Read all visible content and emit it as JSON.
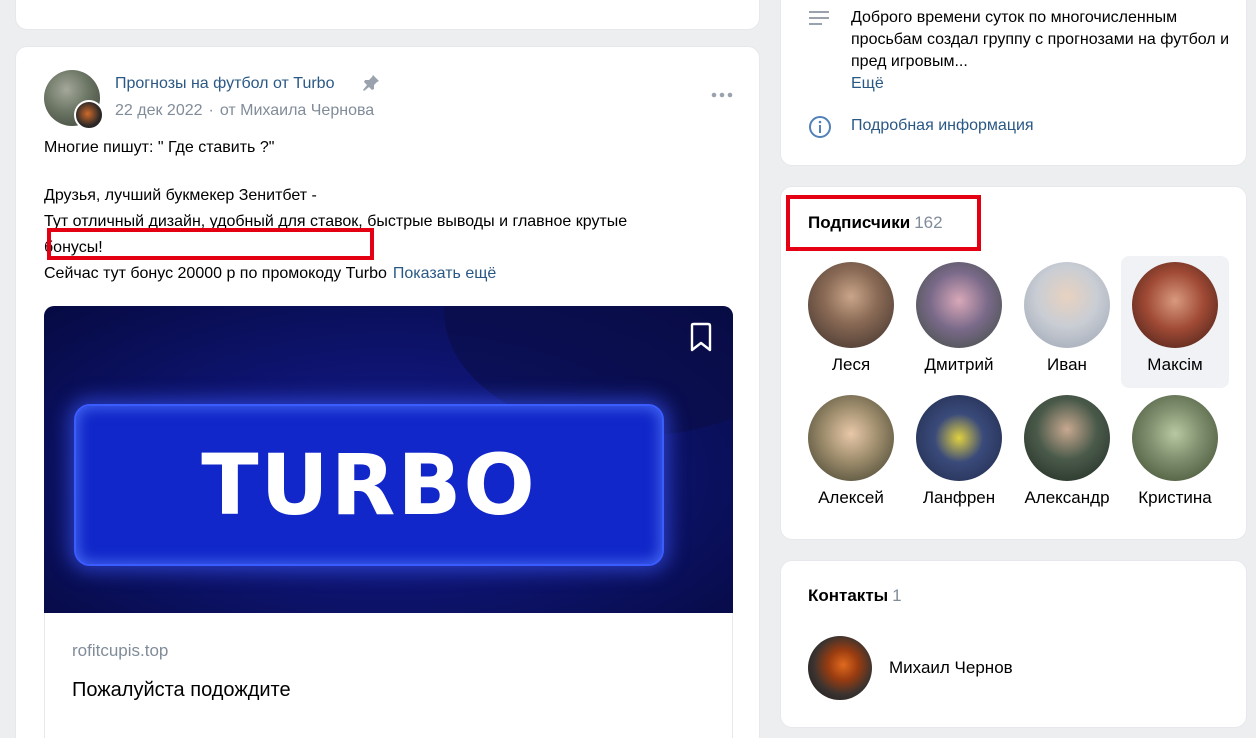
{
  "post": {
    "author": "Прогнозы на футбол от Turbo",
    "date": "22 дек 2022",
    "meta_separator": "·",
    "from": "от Михаила Чернова",
    "lines": [
      "Многие пишут: \" Где ставить ?\"",
      "Друзья, лучший букмекер Зенитбет -",
      "Тут отличный дизайн, удобный для ставок, быстрые выводы и главное крутые",
      "бонусы!",
      "Сейчас тут бонус 20000 р по промокоду Turbo"
    ],
    "show_more": "Показать ещё",
    "media_text": "TURBO",
    "link_domain": "rofitcupis.top",
    "link_title": "Пожалуйста подождите"
  },
  "info": {
    "description": "Доброго времени суток по многочисленным просьбам создал группу с прогнозами на футбол и пред игровым...",
    "more": "Ещё",
    "details_link": "Подробная информация"
  },
  "subscribers": {
    "title": "Подписчики",
    "count": "162",
    "items": [
      {
        "name": "Леся",
        "color": "#8a7060"
      },
      {
        "name": "Дмитрий",
        "color": "#7a6a8a"
      },
      {
        "name": "Иван",
        "color": "#c9cdd4"
      },
      {
        "name": "Максім",
        "color": "#8a3a2a"
      },
      {
        "name": "Алексей",
        "color": "#9a8a6a"
      },
      {
        "name": "Ланфрен",
        "color": "#3a4a7a"
      },
      {
        "name": "Александр",
        "color": "#4a5a4a"
      },
      {
        "name": "Кристина",
        "color": "#7a8a6a"
      }
    ]
  },
  "contacts": {
    "title": "Контакты",
    "count": "1",
    "name": "Михаил Чернов"
  }
}
